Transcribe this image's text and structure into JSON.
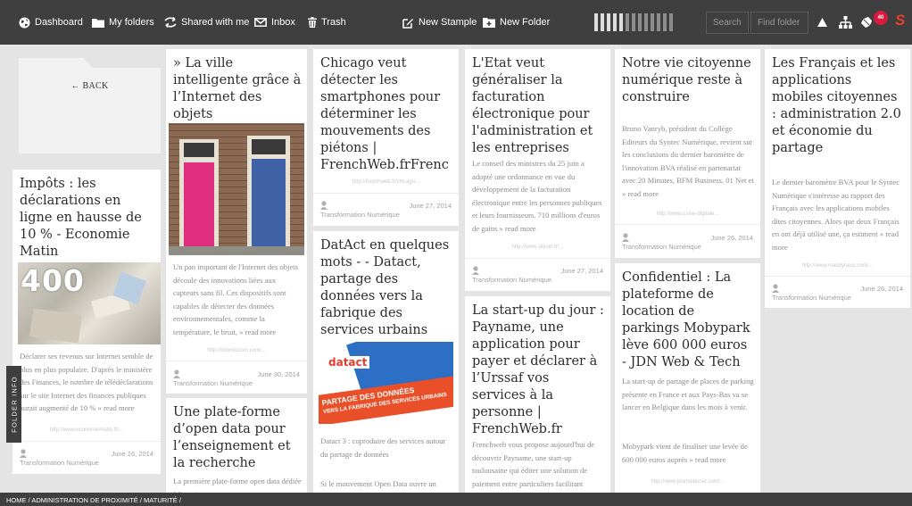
{
  "topbar": {
    "nav": [
      "Dashboard",
      "My folders",
      "Shared with me",
      "Inbox",
      "Trash"
    ],
    "new_stample": "New Stample",
    "new_folder": "New Folder",
    "search": "Search",
    "find_folder": "Find folder",
    "notifications_count": "40",
    "brand_letter": "S"
  },
  "folder": {
    "back": "← BACK"
  },
  "side_tab": "FOLDER INFO",
  "breadcrumb": "HOME / ADMINISTRATION DE PROXIMITÉ / MATURITÉ /",
  "cards": {
    "impots": {
      "title": "Impôts : les déclarations en ligne en hausse de 10 % - Economie Matin",
      "image_text": "400",
      "excerpt": "Déclarer ses revenus sur Internet semble de plus en plus populaire. D'après le ministère des Finances, le nombre de télédéclarations sur le site Internet des finances publiques aurait augmenté de 10 % » read more",
      "url": "http://www.economiematin.fr/...",
      "date": "June 16, 2014",
      "tag": "Transformation Numérique"
    },
    "ville": {
      "title": "» La ville intelligente grâce à l’Internet des objets",
      "excerpt": "Un pan important de l'Internet des objets découle des innovations liées aux capteurs sans fil. Ces dispositifs sont capables de détecter des données environnementales, comme la température, le bruit, » read more",
      "url": "http://infonitocom.com/...",
      "date": "June 30, 2014",
      "tag": "Transformation Numérique"
    },
    "opendata": {
      "title": "Une plate-forme d’open data pour l’enseignement et la recherche",
      "excerpt": "La première plate-forme open data dédiée à l'enseignement"
    },
    "chicago": {
      "title": "Chicago veut détecter les smartphones pour déterminer les mouvements des piétons | FrenchWeb.frFrenc",
      "url": "http://frenchweb.fr/chicago...",
      "date": "June 27, 2014",
      "tag": "Transformation Numérique"
    },
    "datact": {
      "title": "DatAct en quelques mots - - Datact, partage des données vers la fabrique des services urbains",
      "logo": "datact",
      "banner_line1": "PARTAGE DES DONNÉES",
      "banner_line2": "VERS LA FABRIQUE DES SERVICES URBAINS",
      "excerpt": "Datact 3 : coproduire des services autour du partage de données",
      "excerpt2": "Si le mouvement Open Data ouvre un"
    },
    "etat": {
      "title": "L'Etat veut généraliser la facturation électronique pour l'administration et les entreprises",
      "excerpt": "Le conseil des ministres du 25 juin a adopté une ordonnance en vue du développement de la facturation électronique entre les personnes publiques et leurs fournisseurs. 710 millions d'euros de gains » read more",
      "url": "http://www.silicon.fr/...",
      "date": "June 27, 2014",
      "tag": "Transformation Numérique"
    },
    "paymane": {
      "title": "La start-up du jour : Payname, une application pour payer et déclarer à l’Urssaf vos services à la personne | FrenchWeb.fr",
      "excerpt": "Frenchweb vous propose aujourd'hui de découvrir Payname, une start-up toulousaine qui éditer une solution de paiement entre particuliers facilitant"
    },
    "citoyenne": {
      "title": "Notre vie citoyenne numérique reste à construire",
      "excerpt": "Bruno Vanryb, président du Collège Editeurs du Syntec Numérique, revient sur les conclusions du dernier baromètre de l'innovation BVA réalisé en partenariat avec 20 Minutes, BFM Business, 01 Net et » read more",
      "url": "http://www.usine-digitale...",
      "date": "June 26, 2014",
      "tag": "Transformation Numérique"
    },
    "mobypark": {
      "title": "Confidentiel : La plateforme de location de parkings Mobypark lève 600 000 euros - JDN Web & Tech",
      "excerpt": "La start-up de partage de places de parking présente en France et aux Pays-Bas va se lancer en Belgique dans les mois à venir.",
      "excerpt2": "Mobypark vient de finaliser une levée de 600 000 euros auprès » read more",
      "url": "http://www.journaldunet.com/..."
    },
    "francais": {
      "title": "Les Français et les applications mobiles citoyennes : administration 2.0 et économie du partage",
      "excerpt": "Le dernier baromètre BVA pour le Syntec Numérique s'intéresse au rapport des Français avec les applications mobiles dites citoyennes. Alors que deux Français en ont déjà utilisé une, ça estiment » read more",
      "url": "http://www.maddyness.com/...",
      "date": "June 26, 2014",
      "tag": "Transformation Numérique"
    }
  }
}
